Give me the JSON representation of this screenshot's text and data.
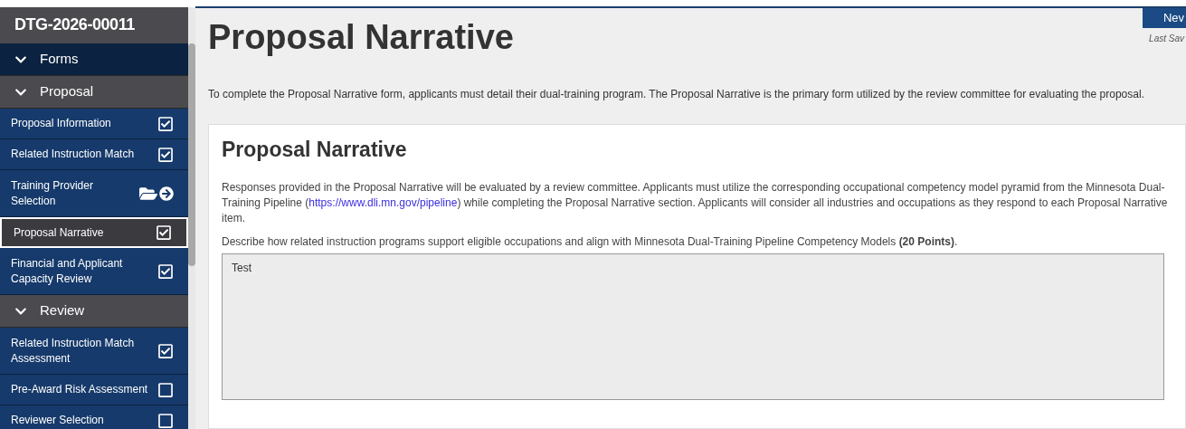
{
  "sidebar": {
    "title": "DTG-2026-00011",
    "sections": [
      {
        "label": "Forms",
        "expanded": true,
        "kind": "root"
      },
      {
        "label": "Proposal",
        "expanded": true,
        "kind": "group",
        "items": [
          {
            "label": "Proposal Information",
            "kind": "checkbox",
            "checked": true,
            "selected": false
          },
          {
            "label": "Related Instruction Match",
            "kind": "checkbox",
            "checked": true,
            "selected": false
          },
          {
            "label": "Training Provider Selection",
            "kind": "folder",
            "selected": false
          },
          {
            "label": "Proposal Narrative",
            "kind": "checkbox",
            "checked": true,
            "selected": true
          },
          {
            "label": "Financial and Applicant Capacity Review",
            "kind": "checkbox",
            "checked": true,
            "selected": false
          }
        ]
      },
      {
        "label": "Review",
        "expanded": true,
        "kind": "group",
        "items": [
          {
            "label": "Related Instruction Match Assessment",
            "kind": "checkbox",
            "checked": true,
            "selected": false
          },
          {
            "label": "Pre-Award Risk Assessment",
            "kind": "checkbox",
            "checked": false,
            "selected": false
          },
          {
            "label": "Reviewer Selection",
            "kind": "checkbox",
            "checked": false,
            "selected": false
          }
        ]
      }
    ]
  },
  "page": {
    "title": "Proposal Narrative",
    "button": "Nev",
    "last_saved": "Last Sav",
    "intro": "To complete the Proposal Narrative form, applicants must detail their dual-training program. The Proposal Narrative is the primary form utilized by the review committee for evaluating the proposal."
  },
  "card": {
    "title": "Proposal Narrative",
    "paragraph_before": "Responses provided in the Proposal Narrative will be evaluated by a review committee. Applicants must utilize the corresponding occupational competency model pyramid from the Minnesota Dual-Training Pipeline (",
    "link": "https://www.dli.mn.gov/pipeline",
    "paragraph_after": ") while completing the Proposal Narrative section. Applicants will consider all industries and occupations as they respond to each Proposal Narrative item.",
    "question": "Describe how related instruction programs support eligible occupations and align with Minnesota Dual-Training Pipeline Competency Models **(20 Points)**.",
    "answer": "Test"
  }
}
